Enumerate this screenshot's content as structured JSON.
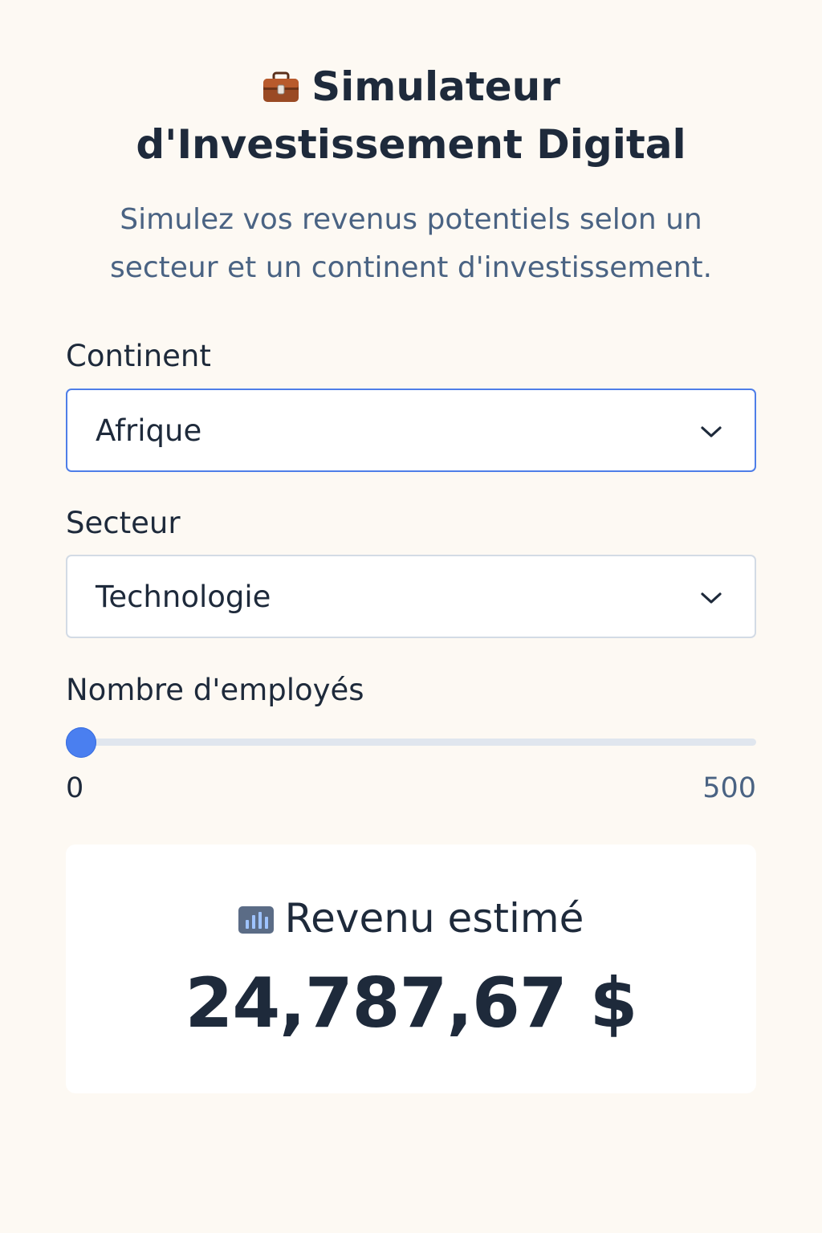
{
  "header": {
    "title": "Simulateur d'Investissement Digital",
    "title_icon": "briefcase-icon",
    "subtitle": "Simulez vos revenus potentiels selon un secteur et un continent d'investissement."
  },
  "form": {
    "continent": {
      "label": "Continent",
      "value": "Afrique",
      "icon": "chevron-down-icon"
    },
    "sector": {
      "label": "Secteur",
      "value": "Technologie",
      "icon": "chevron-down-icon"
    },
    "employees": {
      "label": "Nombre d'employés",
      "min_label": "0",
      "max_label": "500",
      "value": 0,
      "min": 0,
      "max": 500
    }
  },
  "result": {
    "icon": "bar-chart-icon",
    "label": "Revenu estimé",
    "value": "24,787,67 $"
  },
  "colors": {
    "background": "#fdf9f3",
    "text": "#1e2a3b",
    "muted": "#4a6383",
    "accent": "#4a7ff0",
    "focus_border": "#4f7ee8"
  }
}
